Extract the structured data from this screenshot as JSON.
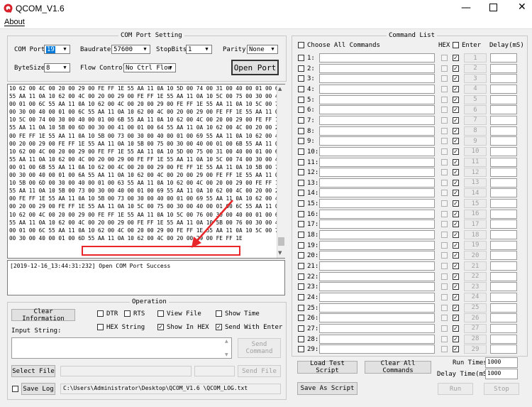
{
  "window": {
    "title": "QCOM_V1.6"
  },
  "menu": {
    "about": "About"
  },
  "com_port": {
    "group_title": "COM Port Setting",
    "port_label": "COM Port:",
    "port_value": "19",
    "baud_label": "Baudrate:",
    "baud_value": "57600",
    "stopbits_label": "StopBits:",
    "stopbits_value": "1",
    "parity_label": "Parity:",
    "parity_value": "None",
    "bytesize_label": "ByteSize:",
    "bytesize_value": "8",
    "flow_label": "Flow Control:",
    "flow_value": "No Ctrl Flow",
    "open_port": "Open Port"
  },
  "receive_lines": [
    "10 62 00 4C 00 20 00 29 00 FE FF 1E 55 AA 11 0A 10 5D 00 74 00 31 00 40 00 01 00 6D",
    "55 AA 11 0A 10 62 00 4C 00 20 00 29 00 FE FF 1E 55 AA 11 0A 10 5C 00 75 00 30 00 40",
    "00 01 00 6C 55 AA 11 0A 10 62 00 4C 00 20 00 29 00 FE FF 1E 55 AA 11 0A 10 5C 00 75",
    "00 30 00 40 00 01 00 6C 55 AA 11 0A 10 62 00 4C 00 20 00 29 00 FE FF 1E 55 AA 11 0A",
    "10 5C 00 74 00 30 00 40 00 01 00 6B 55 AA 11 0A 10 62 00 4C 00 20 00 29 00 FE FF 1E",
    "55 AA 11 0A 10 5B 00 6D 00 30 00 41 00 01 00 64 55 AA 11 0A 10 62 00 4C 00 20 00 29",
    "00 FE FF 1E 55 AA 11 0A 10 5B 00 73 00 30 00 40 00 01 00 69 55 AA 11 0A 10 62 00 4C",
    "00 20 00 29 00 FE FF 1E 55 AA 11 0A 10 5B 00 75 00 30 00 40 00 01 00 6B 55 AA 11 0A",
    "10 62 00 4C 00 20 00 29 00 FE FF 1E 55 AA 11 0A 10 5D 00 75 00 31 00 40 00 01 00 6E",
    "55 AA 11 0A 10 62 00 4C 00 20 00 29 00 FE FF 1E 55 AA 11 0A 10 5C 00 74 00 30 00 40",
    "00 01 00 6B 55 AA 11 0A 10 62 00 4C 00 20 00 29 00 FE FF 1E 55 AA 11 0A 10 5B 00 74",
    "00 30 00 40 00 01 00 6A 55 AA 11 0A 10 62 00 4C 00 20 00 29 00 FE FF 1E 55 AA 11 0A",
    "10 5B 00 6D 00 30 00 40 00 01 00 63 55 AA 11 0A 10 62 00 4C 00 20 00 29 00 FE FF 1E",
    "55 AA 11 0A 10 5B 00 73 00 30 00 40 00 01 00 69 55 AA 11 0A 10 62 00 4C 00 20 00 29",
    "00 FE FF 1E 55 AA 11 0A 10 5B 00 73 00 30 00 40 00 01 00 69 55 AA 11 0A 10 62 00 4C",
    "00 20 00 29 00 FE FF 1E 55 AA 11 0A 10 5C 00 75 00 30 00 40 00 01 00 6C 55 AA 11 0A",
    "10 62 00 4C 00 20 00 29 00 FE FF 1E 55 AA 11 0A 10 5C 00 76 00 30 00 40 00 01 00 6D",
    "55 AA 11 0A 10 62 00 4C 00 20 00 29 00 FE FF 1E 55 AA 11 0A 10 5B 00 76 00 30 00 40",
    "00 01 00 6C 55 AA 11 0A 10 62 00 4C 00 20 00 29 00 FE FF 1E 55 AA 11 0A 10 5C 00 76",
    "00 30 00 40 00 01 00 6D 55 AA 11 0A 10 62 00 4C 00 20 00 29 00 FE FF 1E"
  ],
  "log_text": "[2019-12-16_13:44:31:232] Open COM Port Success",
  "operation": {
    "group_title": "Operation",
    "clear_info": "Clear Information",
    "dtr": "DTR",
    "rts": "RTS",
    "view_file": "View File",
    "show_time": "Show Time",
    "hex_string": "HEX String",
    "show_in_hex": "Show In HEX",
    "send_with_enter": "Send With Enter",
    "input_label": "Input String:",
    "send_command": "Send Command",
    "select_file": "Select File",
    "send_file": "Send File",
    "save_log": "Save Log",
    "log_path": "C:\\Users\\Administrator\\Desktop\\QCOM_V1.6 \\QCOM_LOG.txt"
  },
  "command_list": {
    "group_title": "Command List",
    "choose_all": "Choose All Commands",
    "hex_header": "HEX",
    "enter_header": "Enter",
    "delay_header": "Delay(mS)",
    "rows": [
      "1:",
      "2:",
      "3:",
      "4:",
      "5:",
      "6:",
      "7:",
      "8:",
      "9:",
      "10:",
      "11:",
      "12:",
      "13:",
      "14:",
      "15:",
      "16:",
      "17:",
      "18:",
      "19:",
      "20:",
      "21:",
      "22:",
      "23:",
      "24:",
      "25:",
      "26:",
      "27:",
      "28:",
      "29:"
    ],
    "buttons": [
      "1",
      "2",
      "3",
      "4",
      "5",
      "6",
      "7",
      "8",
      "9",
      "10",
      "11",
      "12",
      "13",
      "14",
      "15",
      "16",
      "17",
      "18",
      "19",
      "20",
      "21",
      "22",
      "23",
      "24",
      "25",
      "26",
      "27",
      "28",
      "29"
    ],
    "load_script": "Load Test Script",
    "clear_all": "Clear All Commands",
    "save_script": "Save As Script",
    "run_times_label": "Run Times:",
    "run_times_value": "1000",
    "delay_time_label": "Delay Time(mS):",
    "delay_time_value": "1000",
    "run": "Run",
    "stop": "Stop"
  },
  "colors": {
    "annotation": "#e8262a",
    "selection": "#0078d7"
  }
}
